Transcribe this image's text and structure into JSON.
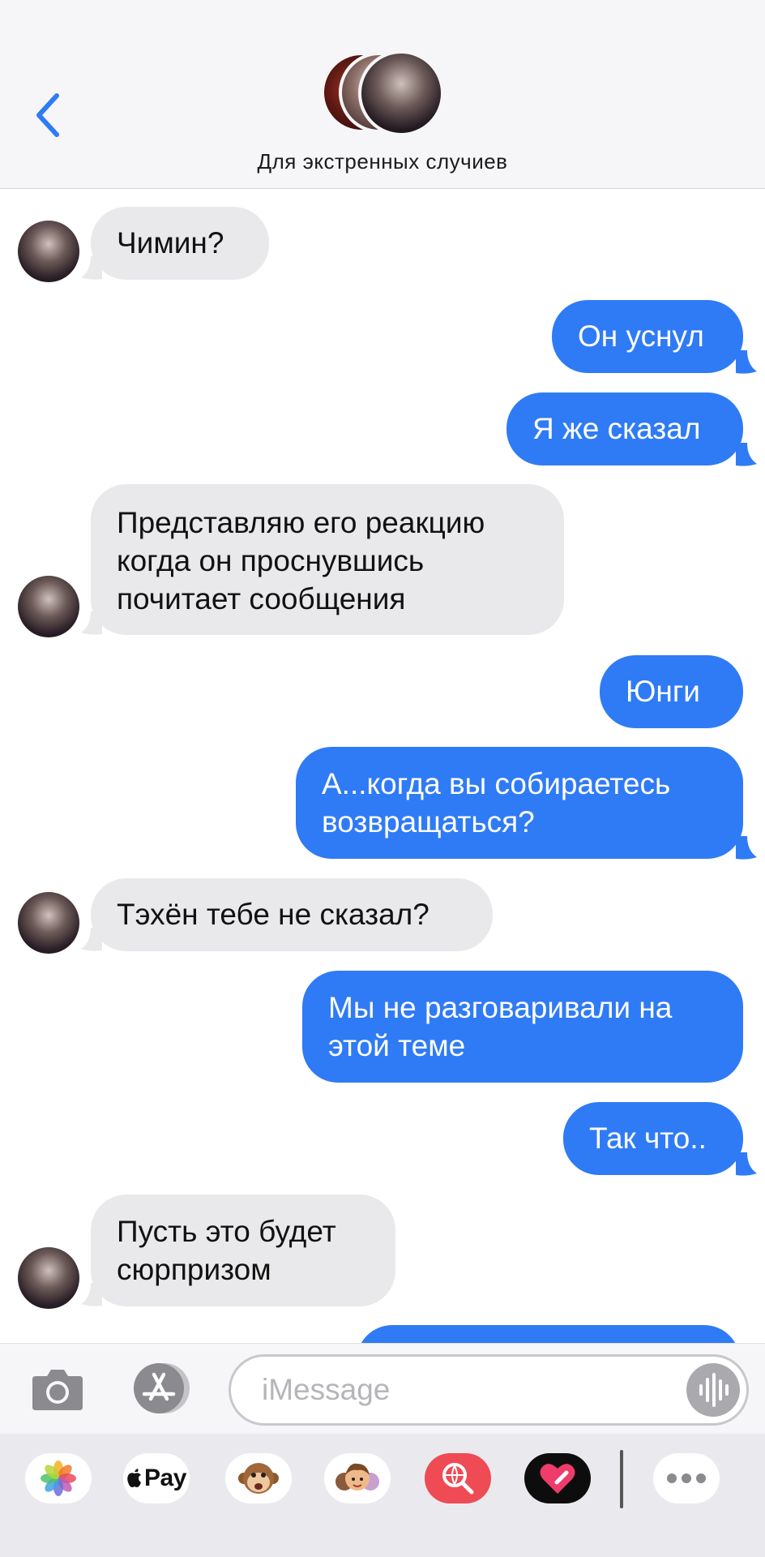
{
  "header": {
    "title": "Для экстренных случиев"
  },
  "composer": {
    "placeholder": "iMessage"
  },
  "app_strip": {
    "apple_pay_label": "Pay"
  },
  "messages": [
    {
      "from": "them",
      "lines": [
        "Чимин?"
      ]
    },
    {
      "from": "me",
      "lines": [
        "Он уснул"
      ]
    },
    {
      "from": "me",
      "lines": [
        "Я же сказал"
      ]
    },
    {
      "from": "them",
      "lines": [
        "Представляю его реакцию",
        "когда он проснувшись",
        "почитает сообщения"
      ]
    },
    {
      "from": "me",
      "lines": [
        "Юнги"
      ]
    },
    {
      "from": "me",
      "lines": [
        "А...когда вы собираетесь",
        "возвращаться?"
      ]
    },
    {
      "from": "them",
      "lines": [
        "Тэхён тебе не сказал?"
      ]
    },
    {
      "from": "me",
      "lines": [
        "Мы не разговаривали на",
        "этой теме"
      ]
    },
    {
      "from": "me",
      "lines": [
        "Так что.."
      ]
    },
    {
      "from": "them",
      "lines": [
        "Пусть это будет",
        "сюрпризом"
      ]
    }
  ],
  "colors": {
    "outgoing": "#2f7bf5",
    "incoming": "#e9e9eb",
    "accent": "#2f7bf5"
  }
}
